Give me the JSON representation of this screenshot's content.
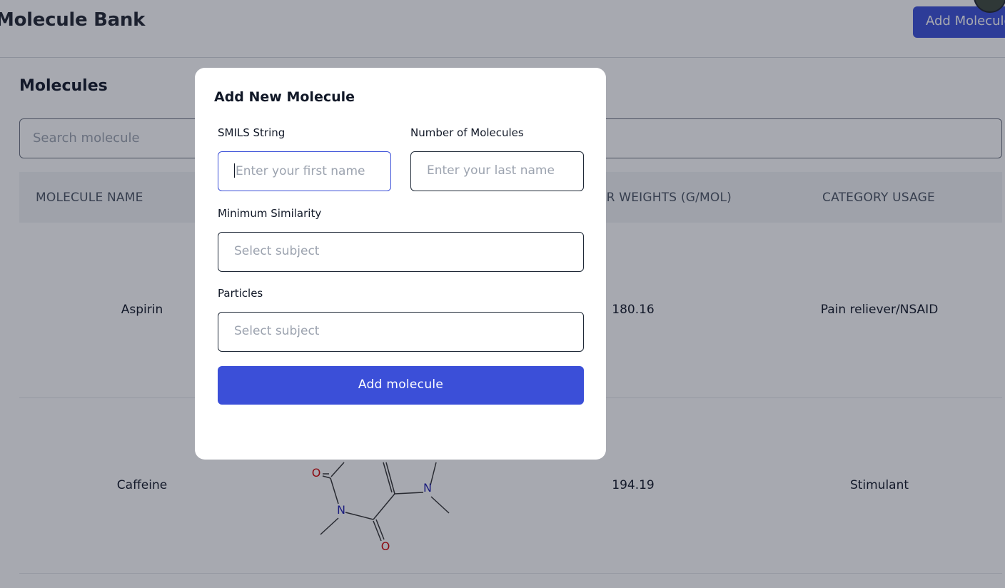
{
  "app": {
    "title": "Molecule Bank",
    "add_button_label": "Add Molecule"
  },
  "page": {
    "section_title": "Molecules",
    "search_placeholder": "Search molecule"
  },
  "table": {
    "columns": [
      "Molecule Name",
      "",
      "",
      "Molecular Weights (g/mol)",
      "Category Usage"
    ],
    "rows": [
      {
        "name": "Aspirin",
        "weight": "180.16",
        "category": "Pain reliever/NSAID"
      },
      {
        "name": "Caffeine",
        "weight": "194.19",
        "category": "Stimulant"
      }
    ],
    "structure_atoms": {
      "oxygen": "O",
      "nitrogen": "N"
    }
  },
  "modal": {
    "title": "Add New Molecule",
    "smiles_label": "SMILS String",
    "smiles_placeholder": "Enter your first name",
    "count_label": "Number of Molecules",
    "count_placeholder": "Enter your last name",
    "similarity_label": "Minimum Similarity",
    "similarity_placeholder": "Select subject",
    "particles_label": "Particles",
    "particles_placeholder": "Select subject",
    "submit_label": "Add molecule"
  },
  "colors": {
    "accent": "#3b4fd8",
    "oxygen": "#d40000",
    "nitrogen": "#1c1cb0"
  }
}
